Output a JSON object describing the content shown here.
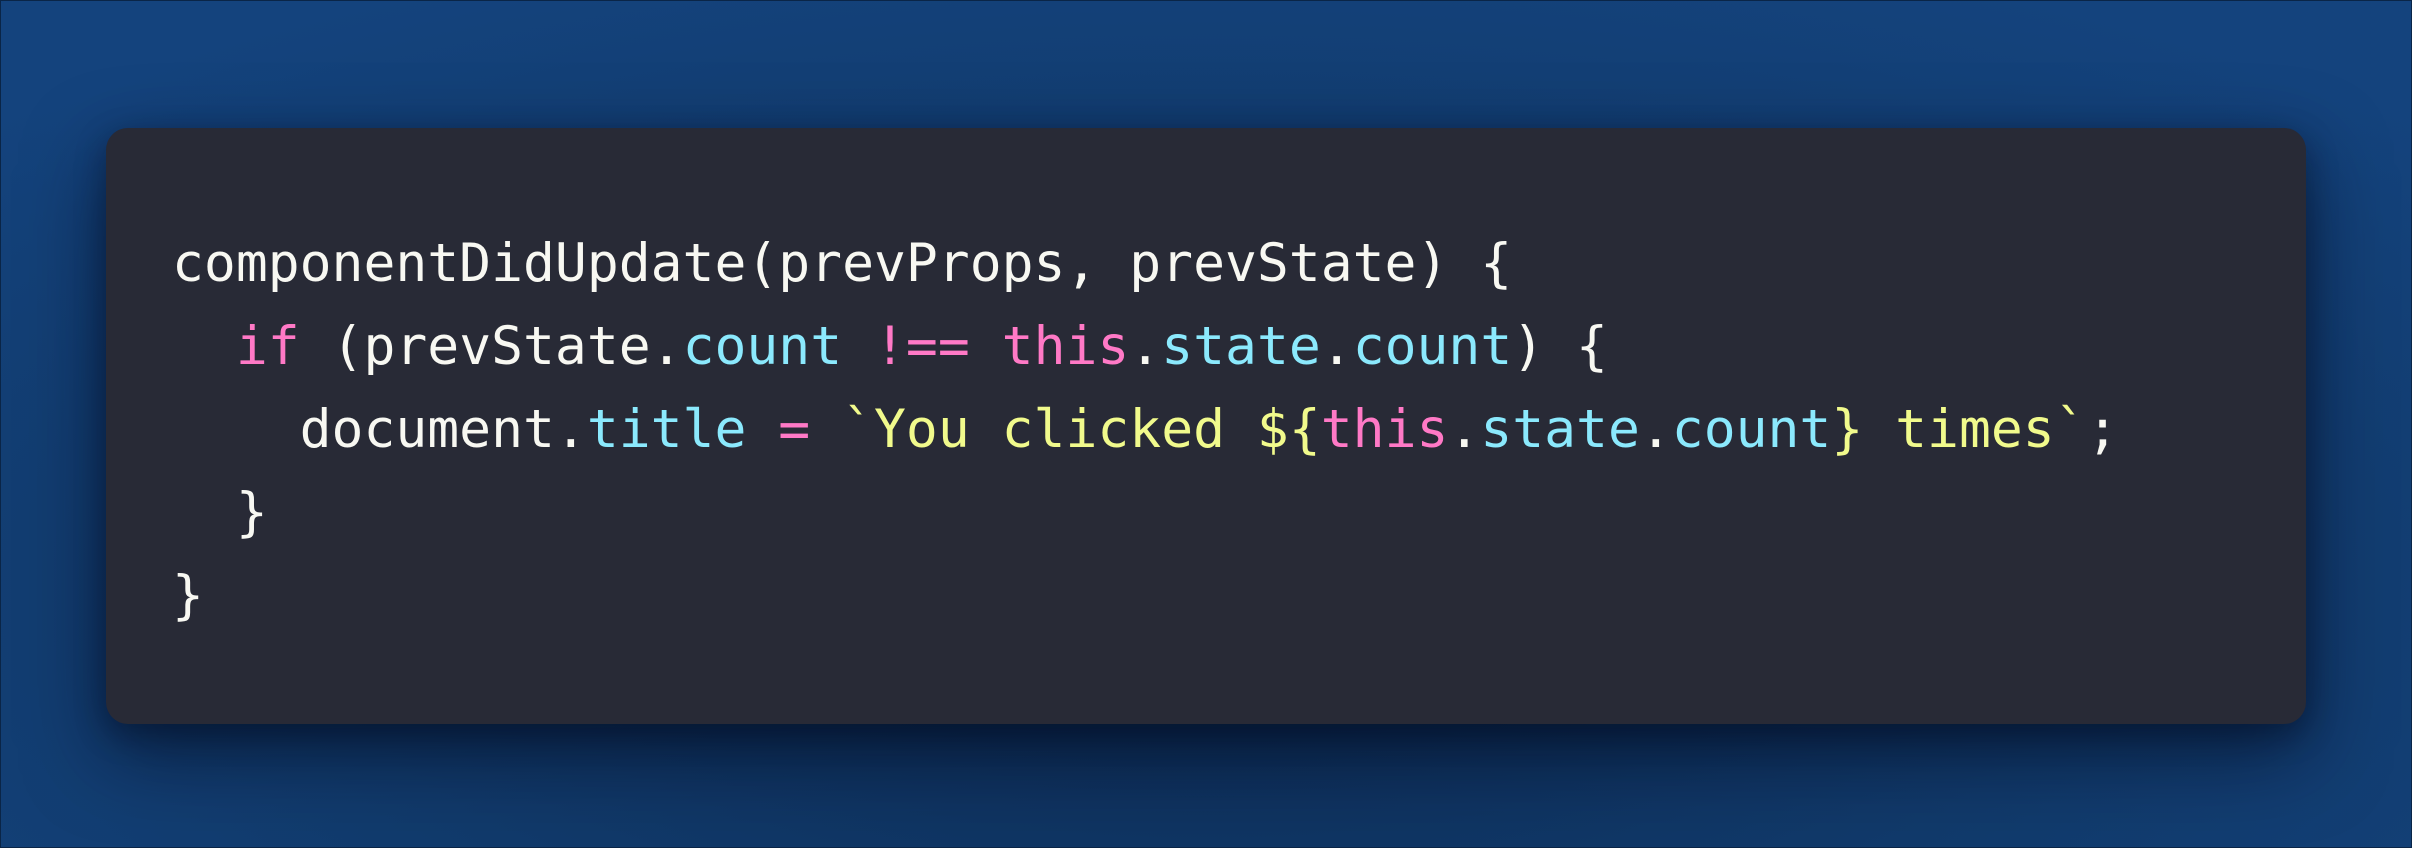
{
  "colors": {
    "background": "#123d72",
    "card": "#282a36",
    "plain": "#f8f8f2",
    "keyword": "#ff79c6",
    "property": "#8be9fd",
    "string": "#f1fa8c"
  },
  "code": {
    "line1": {
      "text": "componentDidUpdate(prevProps, prevState) {"
    },
    "line2": {
      "indent": "  ",
      "if": "if",
      "open": " (prevState.",
      "count1": "count",
      "neq": " !== ",
      "this": "this",
      "dot1": ".",
      "state": "state",
      "dot2": ".",
      "count2": "count",
      "close": ") {"
    },
    "line3": {
      "indent": "    ",
      "document": "document.",
      "title": "title",
      "assign": " = ",
      "str_start": "`You clicked ${",
      "this": "this",
      "dot1": ".",
      "state": "state",
      "dot2": ".",
      "count": "count",
      "str_end": "} times`",
      "semi": ";"
    },
    "line4": {
      "text": "  }"
    },
    "line5": {
      "text": "}"
    }
  }
}
